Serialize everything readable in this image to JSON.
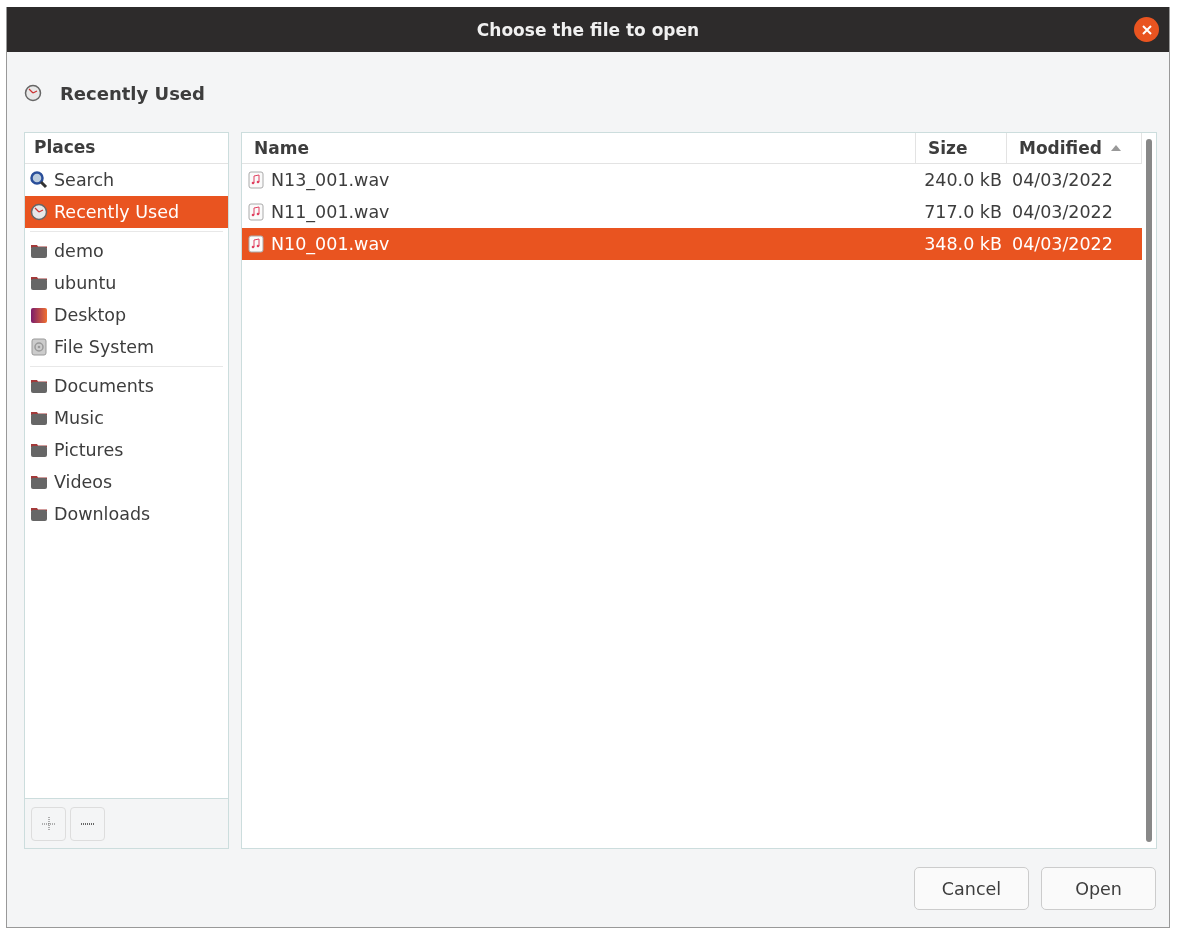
{
  "window": {
    "title": "Choose the file to open"
  },
  "location": {
    "label": "Recently Used"
  },
  "places": {
    "header": "Places",
    "groups": [
      {
        "items": [
          {
            "kind": "search",
            "label": "Search",
            "selected": false
          },
          {
            "kind": "recent",
            "label": "Recently Used",
            "selected": true
          }
        ]
      },
      {
        "items": [
          {
            "kind": "folder",
            "label": "demo",
            "selected": false
          },
          {
            "kind": "folder",
            "label": "ubuntu",
            "selected": false
          },
          {
            "kind": "desktop",
            "label": "Desktop",
            "selected": false
          },
          {
            "kind": "drive",
            "label": "File System",
            "selected": false
          }
        ]
      },
      {
        "items": [
          {
            "kind": "folder",
            "label": "Documents",
            "selected": false
          },
          {
            "kind": "folder",
            "label": "Music",
            "selected": false
          },
          {
            "kind": "folder",
            "label": "Pictures",
            "selected": false
          },
          {
            "kind": "folder",
            "label": "Videos",
            "selected": false
          },
          {
            "kind": "folder",
            "label": "Downloads",
            "selected": false
          }
        ]
      }
    ]
  },
  "table": {
    "columns": [
      "Name",
      "Size",
      "Modified"
    ],
    "rows": [
      {
        "name": "N13_001.wav",
        "size": "240.0 kB",
        "modified": "04/03/2022",
        "selected": false
      },
      {
        "name": "N11_001.wav",
        "size": "717.0 kB",
        "modified": "04/03/2022",
        "selected": false
      },
      {
        "name": "N10_001.wav",
        "size": "348.0 kB",
        "modified": "04/03/2022",
        "selected": true
      }
    ]
  },
  "buttons": [
    "Cancel",
    "Open"
  ]
}
